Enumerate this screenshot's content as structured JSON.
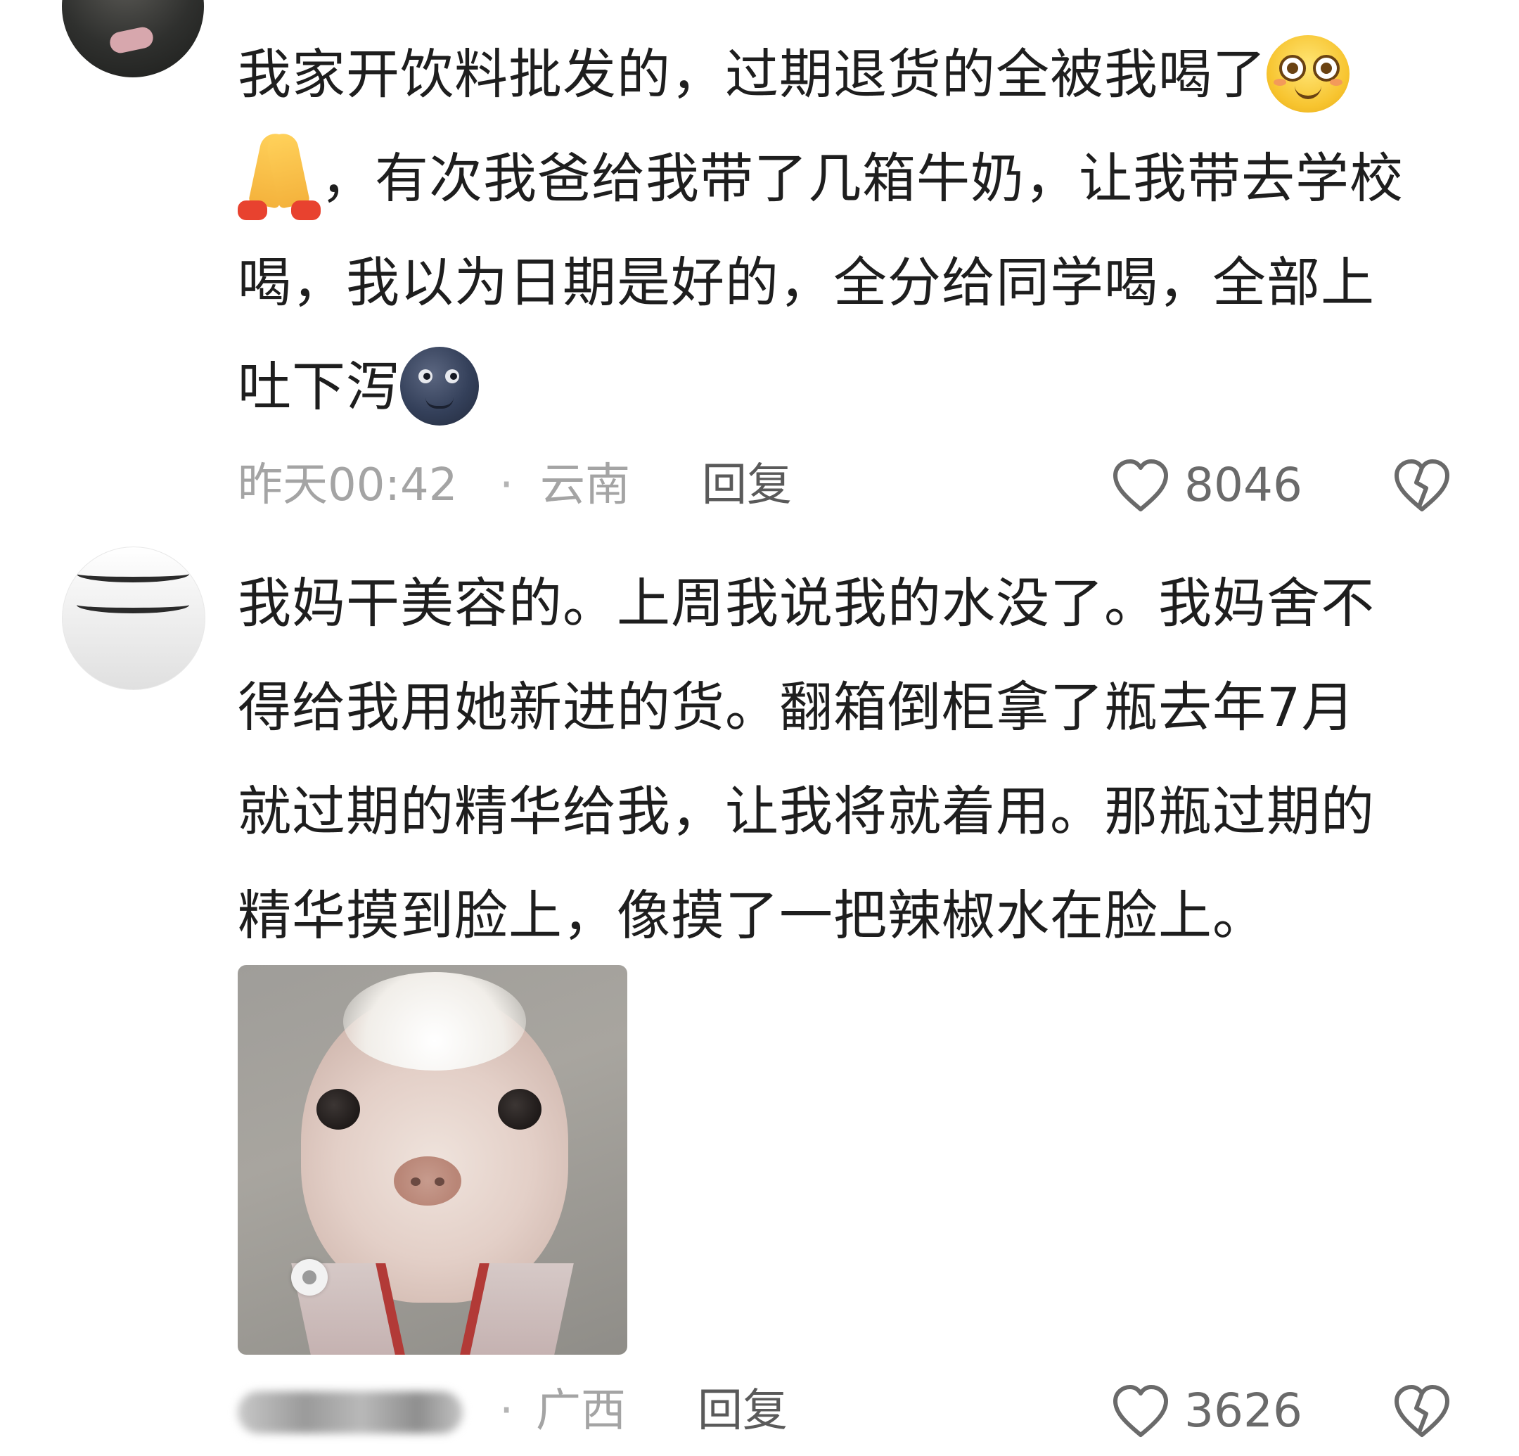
{
  "colors": {
    "text": "#1e1e1e",
    "meta": "#a4a4a4",
    "reply": "#5a5a5a",
    "icon": "#6a6a6a"
  },
  "comments": [
    {
      "lines": [
        "我家开饮料批发的，过期退货的全被我喝了",
        "，有次我爸给我带了几箱牛奶，让我带去学校",
        "喝，我以为日期是好的，全分给同学喝，全部上",
        "吐下泻"
      ],
      "emojis": [
        "flushed-face-emoji",
        "folded-hands-emoji",
        "new-moon-face-emoji"
      ],
      "time": "昨天00:42",
      "separator": "·",
      "region": "云南",
      "reply_label": "回复",
      "likes": "8046",
      "like_icon": "heart-icon",
      "dislike_icon": "broken-heart-icon"
    },
    {
      "lines": [
        "我妈干美容的。上周我说我的水没了。我妈舍不",
        "得给我用她新进的货。翻箱倒柜拿了瓶去年7月",
        "就过期的精华给我，让我将就着用。那瓶过期的",
        "精华摸到脸上，像摸了一把辣椒水在脸上。"
      ],
      "image": "dog-meme-image",
      "time_blurred": true,
      "separator": "·",
      "region": "广西",
      "reply_label": "回复",
      "likes": "3626",
      "like_icon": "heart-icon",
      "dislike_icon": "broken-heart-icon"
    }
  ]
}
